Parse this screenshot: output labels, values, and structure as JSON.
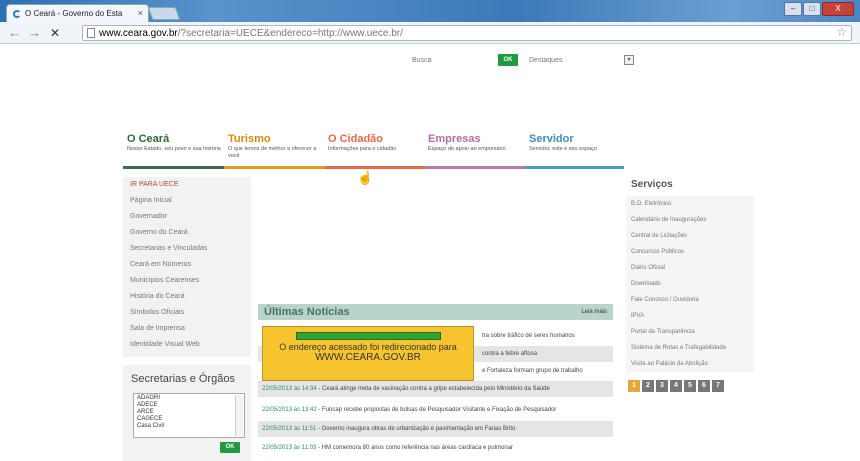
{
  "browser": {
    "tab_title": "O Ceará - Governo do Esta",
    "tab_close": "×",
    "window_min": "–",
    "window_max": "□",
    "window_close": "X",
    "nav_back": "←",
    "nav_forward": "→",
    "nav_stop": "✕",
    "url_domain": "www.ceara.gov.br",
    "url_path": "/?secretaria=UECE&endereco=http://www.uece.br/",
    "star": "☆"
  },
  "header": {
    "busca_label": "Busca",
    "ok_label": "OK",
    "destaques_label": "Destaques",
    "select_arrow": "▾"
  },
  "main_nav": [
    {
      "title": "O Ceará",
      "desc": "Nosso Estado, seu povo e sua história",
      "color": "#3b6b4c",
      "title_color": "#2f6a3a"
    },
    {
      "title": "Turismo",
      "desc": "O que temos de melhor a oferecer a você",
      "color": "#e39a1a",
      "title_color": "#d98a10"
    },
    {
      "title": "O Cidadão",
      "desc": "Informações para o cidadão",
      "color": "#e56a4a",
      "title_color": "#e5694a"
    },
    {
      "title": "Empresas",
      "desc": "Espaço de apoio ao empresário",
      "color": "#b17bb0",
      "title_color": "#b06ea9"
    },
    {
      "title": "Servidor",
      "desc": "Servidor, este é seu espaço",
      "color": "#4a9ac0",
      "title_color": "#3c8ab8"
    }
  ],
  "sidebar": {
    "items": [
      "IR PARA UECE",
      "Página Inicial",
      "Governador",
      "Governo do Ceará",
      "Secretarias e Vinculadas",
      "Ceará em Números",
      "Municípios Cearenses",
      "História do Ceará",
      "Símbolos Oficiais",
      "Sala de Imprensa",
      "Identidade Visual Web"
    ]
  },
  "secretarias": {
    "title": "Secretarias e Órgãos",
    "options": [
      "ADAGRI",
      "ADECE",
      "ARCE",
      "CAGECE",
      "Casa Civil"
    ],
    "ok_label": "OK"
  },
  "news": {
    "title": "Últimas Notícias",
    "more": "Leia mais",
    "items": [
      {
        "date": "",
        "text": "tra sobre tráfico de seres humanos"
      },
      {
        "date": "",
        "text": "contra a febre aftosa"
      },
      {
        "date": "",
        "text": "e Fortaleza formam grupo de trabalho"
      },
      {
        "date": "22/05/2013 às 14:34",
        "text": " - Ceará atinge meta de vacinação contra a gripe estabelecida pelo Ministério da Saúde"
      },
      {
        "date": "22/05/2013 às 13:42",
        "text": " - Funcap recebe propostas de bolsas de Pesquisador Visitante e Fixação de Pesquisador"
      },
      {
        "date": "22/05/2013 às 11:51",
        "text": " - Governo inaugura obras de urbanização e pavimentação em Farias Brito"
      },
      {
        "date": "22/05/2013 às 11:03",
        "text": " - HM comemora 80 anos como referência nas áreas cardíaca e pulmonar"
      }
    ]
  },
  "redirect": {
    "line1": "O endereço acessado foi redirecionado para",
    "line2": "WWW.CEARA.GOV.BR",
    "progress": 1.0
  },
  "servicos": {
    "title": "Serviços",
    "items": [
      "B.O. Eletrônico",
      "Calendário de Inaugurações",
      "Central de Licitações",
      "Concursos Públicos",
      "Diário Oficial",
      "Downloads",
      "Fale Conosco / Ouvidoria",
      "IPVA",
      "Portal da Transparência",
      "Sistema de Rotas e Trafegabilidade",
      "Visita ao Palácio da Abolição"
    ],
    "pages": [
      "1",
      "2",
      "3",
      "4",
      "5",
      "6",
      "7"
    ]
  }
}
